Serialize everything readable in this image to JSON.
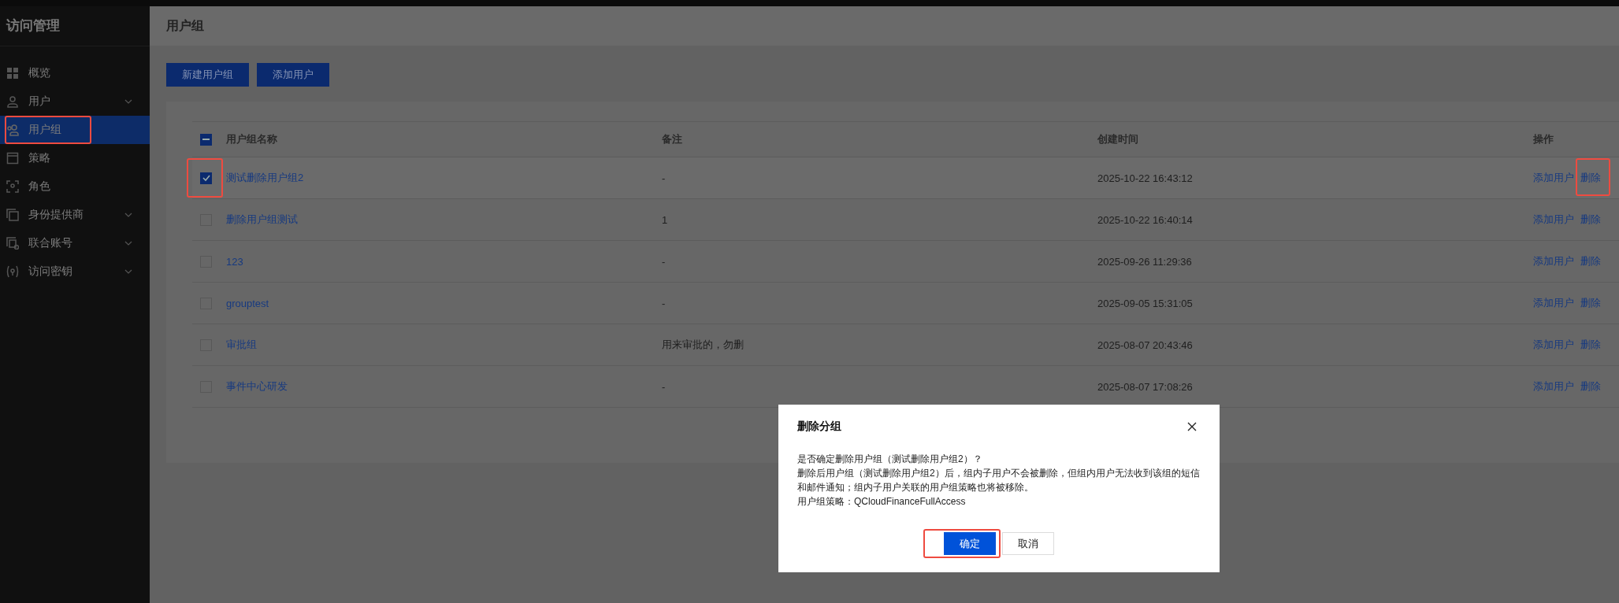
{
  "sidebar": {
    "title": "访问管理",
    "items": [
      {
        "label": "概览",
        "has_submenu": false,
        "selected": false,
        "highlighted": false
      },
      {
        "label": "用户",
        "has_submenu": true,
        "selected": false,
        "highlighted": false
      },
      {
        "label": "用户组",
        "has_submenu": false,
        "selected": true,
        "highlighted": true
      },
      {
        "label": "策略",
        "has_submenu": false,
        "selected": false,
        "highlighted": false
      },
      {
        "label": "角色",
        "has_submenu": false,
        "selected": false,
        "highlighted": false
      },
      {
        "label": "身份提供商",
        "has_submenu": true,
        "selected": false,
        "highlighted": false
      },
      {
        "label": "联合账号",
        "has_submenu": true,
        "selected": false,
        "highlighted": false
      },
      {
        "label": "访问密钥",
        "has_submenu": true,
        "selected": false,
        "highlighted": false
      }
    ]
  },
  "page_title": "用户组",
  "toolbar": [
    "新建用户组",
    "添加用户"
  ],
  "table": {
    "header_indeterminate": true,
    "columns": [
      "用户组名称",
      "备注",
      "创建时间",
      "操作"
    ],
    "rows": [
      {
        "name": "测试删除用户组2",
        "note": "-",
        "created": "2025-10-22 16:43:12",
        "selected": true,
        "checkbox_highlighted": true,
        "actions": [
          {
            "label": "添加用户",
            "highlighted": false
          },
          {
            "label": "删除",
            "highlighted": true
          }
        ]
      },
      {
        "name": "删除用户组测试",
        "note": "1",
        "created": "2025-10-22 16:40:14",
        "selected": false,
        "checkbox_highlighted": false,
        "actions": [
          {
            "label": "添加用户",
            "highlighted": false
          },
          {
            "label": "删除",
            "highlighted": false
          }
        ]
      },
      {
        "name": "123",
        "note": "-",
        "created": "2025-09-26 11:29:36",
        "selected": false,
        "checkbox_highlighted": false,
        "actions": [
          {
            "label": "添加用户",
            "highlighted": false
          },
          {
            "label": "删除",
            "highlighted": false
          }
        ]
      },
      {
        "name": "grouptest",
        "note": "-",
        "created": "2025-09-05 15:31:05",
        "selected": false,
        "checkbox_highlighted": false,
        "actions": [
          {
            "label": "添加用户",
            "highlighted": false
          },
          {
            "label": "删除",
            "highlighted": false
          }
        ]
      },
      {
        "name": "审批组",
        "note": "用来审批的，勿删",
        "created": "2025-08-07 20:43:46",
        "selected": false,
        "checkbox_highlighted": false,
        "actions": [
          {
            "label": "添加用户",
            "highlighted": false
          },
          {
            "label": "删除",
            "highlighted": false
          }
        ]
      },
      {
        "name": "事件中心研发",
        "note": "-",
        "created": "2025-08-07 17:08:26",
        "selected": false,
        "checkbox_highlighted": false,
        "actions": [
          {
            "label": "添加用户",
            "highlighted": false
          },
          {
            "label": "删除",
            "highlighted": false
          }
        ]
      }
    ]
  },
  "dialog": {
    "title": "删除分组",
    "paragraphs": [
      "是否确定删除用户组（测试删除用户组2）？",
      "删除后用户组（测试删除用户组2）后，组内子用户不会被删除，但组内用户无法收到该组的短信和邮件通知；组内子用户关联的用户组策略也将被移除。",
      "用户组策略：QCloudFinanceFullAccess"
    ],
    "buttons": [
      {
        "label": "确定",
        "kind": "primary",
        "highlighted": true
      },
      {
        "label": "取消",
        "kind": "default",
        "highlighted": false
      }
    ]
  }
}
